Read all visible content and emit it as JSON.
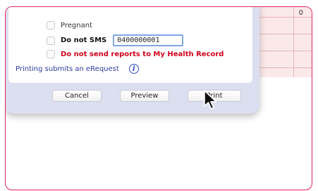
{
  "background_table": {
    "cell_value": "0"
  },
  "dialog": {
    "options": {
      "pregnant_label": "Pregnant",
      "do_not_sms_label": "Do not SMS",
      "sms_number": "0400000001",
      "do_not_send_label": "Do not send reports to My Health Record"
    },
    "printing_note": "Printing submits an eRequest",
    "info_icon_glyph": "i",
    "buttons": {
      "cancel": "Cancel",
      "preview": "Preview",
      "print": "Print"
    }
  },
  "colors": {
    "frame_border": "#e0245e",
    "warning_red": "#d0021b",
    "link_blue": "#2f3aa0",
    "dialog_bg": "#dcdff0",
    "table_bg": "#fbe9ea"
  }
}
